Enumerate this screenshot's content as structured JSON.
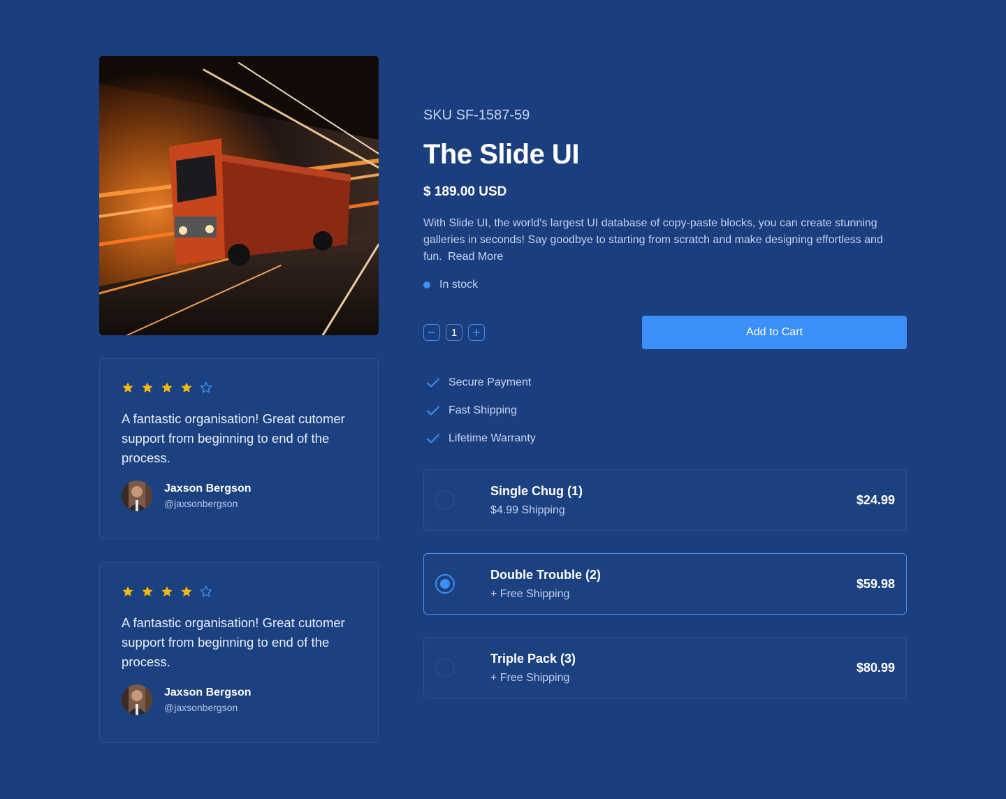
{
  "product": {
    "sku": "SKU SF-1587-59",
    "title": "The Slide UI",
    "price": "$ 189.00 USD",
    "description": "With Slide UI, the world's largest UI database of copy-paste blocks, you can create stunning galleries in seconds! Say goodbye to starting from scratch and make designing effortless and fun.",
    "read_more": "Read More",
    "stock_status": "In stock",
    "image_alt": "red truck speeding through tunnel",
    "colors": {
      "accent": "#3b8ff6",
      "background": "#1b3f7e",
      "star": "#f5b80b"
    }
  },
  "cart": {
    "quantity": "1",
    "decrement_icon": "minus-icon",
    "increment_icon": "plus-icon",
    "add_label": "Add to Cart"
  },
  "features": [
    {
      "icon": "check-icon",
      "label": "Secure Payment"
    },
    {
      "icon": "check-icon",
      "label": "Fast Shipping"
    },
    {
      "icon": "check-icon",
      "label": "Lifetime Warranty"
    }
  ],
  "options": [
    {
      "name": "Single Chug (1)",
      "shipping": "$4.99 Shipping",
      "price": "$24.99",
      "selected": false
    },
    {
      "name": "Double Trouble (2)",
      "shipping": "+ Free Shipping",
      "price": "$59.98",
      "selected": true
    },
    {
      "name": "Triple Pack (3)",
      "shipping": "+ Free Shipping",
      "price": "$80.99",
      "selected": false
    }
  ],
  "reviews": [
    {
      "rating": 4,
      "max_rating": 5,
      "text": "A fantastic organisation! Great cutomer support from beginning to end of the process.",
      "name": "Jaxson Bergson",
      "handle": "@jaxsonbergson"
    },
    {
      "rating": 4,
      "max_rating": 5,
      "text": "A fantastic organisation! Great cutomer support from beginning to end of the process.",
      "name": "Jaxson Bergson",
      "handle": "@jaxsonbergson"
    }
  ]
}
